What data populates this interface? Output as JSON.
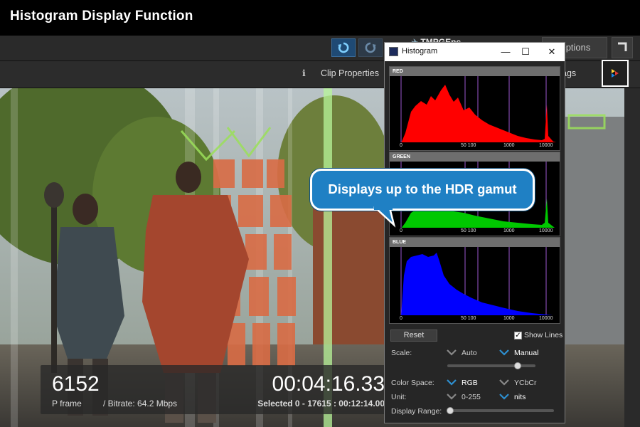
{
  "banner": {
    "title": "Histogram Display Function"
  },
  "toolbar": {
    "brand": "TMPGEnc",
    "options_label": "Options",
    "clip_properties_label": "Clip Properties",
    "settings_fragment": "ags"
  },
  "overlay": {
    "frame_number": "6152",
    "frame_type": "P frame",
    "bitrate": "/ Bitrate: 64.2 Mbps",
    "timecode": "00:04:16.33",
    "selected": "Selected 0 - 17615 : 00:12:14.00"
  },
  "histogram_window": {
    "title": "Histogram",
    "controls": {
      "minimize": "—",
      "maximize": "☐",
      "close": "✕"
    },
    "panels": [
      {
        "label": "RED",
        "color": "#ff0000"
      },
      {
        "label": "GREEN",
        "color": "#00c800"
      },
      {
        "label": "BLUE",
        "color": "#0000ff"
      }
    ],
    "axis_ticks": [
      "0",
      "50 100",
      "1000",
      "10000"
    ],
    "reset_label": "Reset",
    "show_lines": {
      "label": "Show Lines",
      "checked": true
    },
    "scale": {
      "label": "Scale:",
      "options": [
        "Auto",
        "Manual"
      ],
      "selected": "Manual",
      "level": 0.8
    },
    "color_space": {
      "label": "Color Space:",
      "options": [
        "RGB",
        "YCbCr"
      ],
      "selected": "RGB"
    },
    "unit": {
      "label": "Unit:",
      "options": [
        "0-255",
        "nits"
      ],
      "selected": "nits"
    },
    "display_range": {
      "label": "Display Range:",
      "level": 0.0
    }
  },
  "callout": {
    "text": "Displays up to the HDR gamut"
  },
  "colors": {
    "accent": "#1f80c4",
    "chevron": "#2d8fd0",
    "line_marker": "#9b59d0"
  }
}
